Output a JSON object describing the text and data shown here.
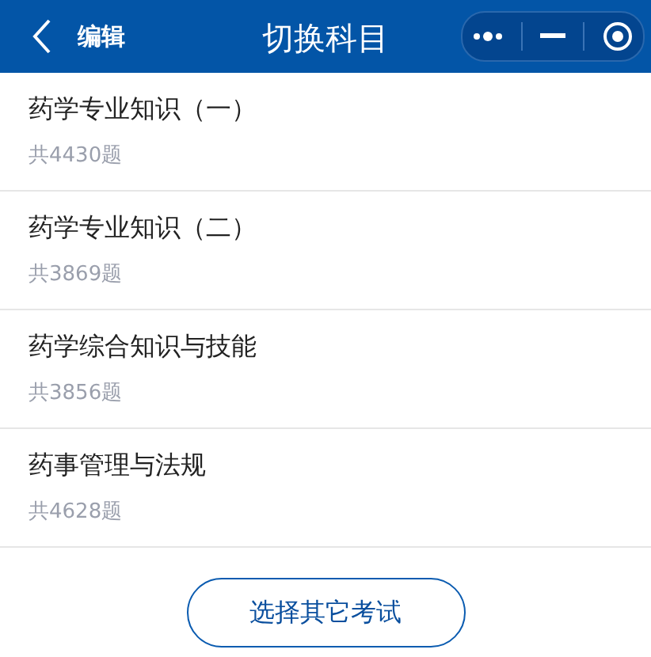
{
  "header": {
    "left_label": "编辑",
    "title": "切换科目"
  },
  "subjects": [
    {
      "name": "药学专业知识（一）",
      "count": "共4430题"
    },
    {
      "name": "药学专业知识（二）",
      "count": "共3869题"
    },
    {
      "name": "药学综合知识与技能",
      "count": "共3856题"
    },
    {
      "name": "药事管理与法规",
      "count": "共4628题"
    }
  ],
  "action_button": "选择其它考试"
}
